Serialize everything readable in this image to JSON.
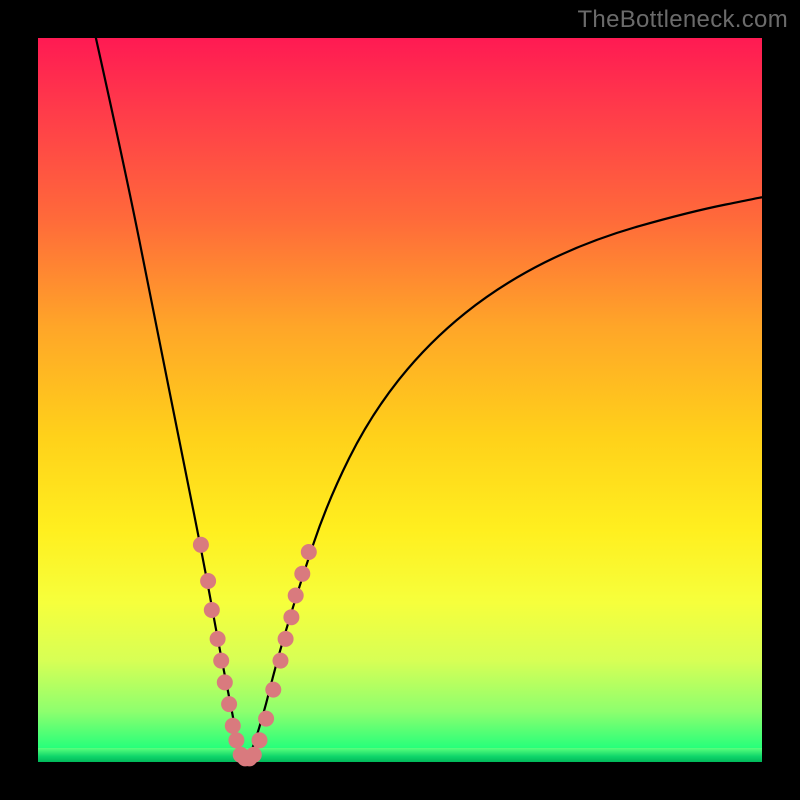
{
  "watermark": "TheBottleneck.com",
  "chart_data": {
    "type": "line",
    "title": "",
    "xlabel": "",
    "ylabel": "",
    "xlim": [
      0,
      100
    ],
    "ylim": [
      0,
      100
    ],
    "legend": false,
    "grid": false,
    "background_gradient": {
      "top": "#ff1a53",
      "mid": "#ffd11a",
      "bottom": "#00e56a",
      "meaning": "color indicates bottleneck severity (red=high, green=low)"
    },
    "series": [
      {
        "name": "bottleneck-curve",
        "description": "V-shaped bottleneck curve; minimum near x≈28 where bottleneck≈0",
        "x": [
          8,
          12,
          16,
          20,
          23,
          25,
          27,
          28,
          29,
          31,
          33,
          36,
          40,
          46,
          54,
          64,
          76,
          90,
          100
        ],
        "values": [
          100,
          82,
          62,
          42,
          27,
          16,
          6,
          0,
          0,
          6,
          14,
          24,
          36,
          48,
          58,
          66,
          72,
          76,
          78
        ]
      }
    ],
    "markers": {
      "description": "highlighted points (pink dots) on both flanks of the V near the bottom",
      "points": [
        {
          "x": 22.5,
          "y": 30
        },
        {
          "x": 23.5,
          "y": 25
        },
        {
          "x": 24.0,
          "y": 21
        },
        {
          "x": 24.8,
          "y": 17
        },
        {
          "x": 25.3,
          "y": 14
        },
        {
          "x": 25.8,
          "y": 11
        },
        {
          "x": 26.4,
          "y": 8
        },
        {
          "x": 26.9,
          "y": 5
        },
        {
          "x": 27.4,
          "y": 3
        },
        {
          "x": 28.0,
          "y": 1
        },
        {
          "x": 28.6,
          "y": 0.5
        },
        {
          "x": 29.2,
          "y": 0.5
        },
        {
          "x": 29.8,
          "y": 1
        },
        {
          "x": 30.6,
          "y": 3
        },
        {
          "x": 31.5,
          "y": 6
        },
        {
          "x": 32.5,
          "y": 10
        },
        {
          "x": 33.5,
          "y": 14
        },
        {
          "x": 34.2,
          "y": 17
        },
        {
          "x": 35.0,
          "y": 20
        },
        {
          "x": 35.6,
          "y": 23
        },
        {
          "x": 36.5,
          "y": 26
        },
        {
          "x": 37.4,
          "y": 29
        }
      ]
    }
  }
}
